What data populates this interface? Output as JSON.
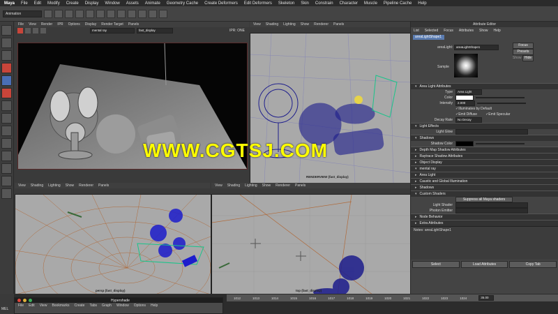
{
  "menubar": {
    "app": "Maya",
    "items": [
      "File",
      "Edit",
      "Modify",
      "Create",
      "Display",
      "Window",
      "Assets",
      "Animate",
      "Geometry Cache",
      "Create Deformers",
      "Edit Deformers",
      "Skeleton",
      "Skin",
      "Constrain",
      "Character",
      "Muscle",
      "Pipeline Cache",
      "Help"
    ]
  },
  "shelf": {
    "mode": "Animation"
  },
  "render_view": {
    "menu": [
      "File",
      "View",
      "Render",
      "IPR",
      "Options",
      "Display",
      "Render Target",
      "Panels"
    ],
    "renderer": "mental ray",
    "camera": "fast_display",
    "ipr_label": "IPR: ONE"
  },
  "viewports": {
    "top_right": {
      "menu": [
        "View",
        "Shading",
        "Lighting",
        "Show",
        "Renderer",
        "Panels"
      ],
      "label": "RENDERVIEW (fast_display)"
    },
    "bottom_left": {
      "menu": [
        "View",
        "Shading",
        "Lighting",
        "Show",
        "Renderer",
        "Panels"
      ],
      "label": "persp (fast_display)"
    },
    "bottom_right": {
      "menu": [
        "View",
        "Shading",
        "Lighting",
        "Show",
        "Renderer",
        "Panels"
      ],
      "label": "top (fast_display)"
    }
  },
  "watermark": "WWW.CGTSJ.COM",
  "attribute_editor": {
    "title": "Attribute Editor",
    "menu": [
      "List",
      "Selected",
      "Focus",
      "Attributes",
      "Show",
      "Help"
    ],
    "tab": "areaLightShape1",
    "node_label": "areaLight:",
    "node_value": "areaLightShape1",
    "focus": "Focus",
    "presets": "Presets",
    "show": "Show",
    "hide": "Hide",
    "sample_label": "Sample",
    "section_area": "Area Light Attributes",
    "type_label": "Type",
    "type_value": "Area Light",
    "color_label": "Color",
    "intensity_label": "Intensity",
    "intensity_value": "2.000",
    "illum_default": "Illuminates by Default",
    "emit_diffuse": "Emit Diffuse",
    "emit_specular": "Emit Specular",
    "decay_label": "Decay Rate",
    "decay_value": "No Decay",
    "light_effects": "Light Effects",
    "light_glow": "Light Glow",
    "shadows": "Shadows",
    "shadow_color": "Shadow Color",
    "depth_map": "Depth Map Shadow Attributes",
    "raytrace": "Raytrace Shadow Attributes",
    "object_display": "Object Display",
    "mental_ray": "mental ray",
    "area_light": "Area Light",
    "caustic": "Caustic and Global Illumination",
    "shadows2": "Shadows",
    "custom_shaders": "Custom Shaders",
    "suppress": "Suppress all Maya shaders",
    "light_shader": "Light Shader",
    "photon_emitter": "Photon Emitter",
    "node_behavior": "Node Behavior",
    "extra_attributes": "Extra Attributes",
    "notes": "Notes: areaLightShape1",
    "select_btn": "Select",
    "load_btn": "Load Attributes",
    "copy_btn": "Copy Tab"
  },
  "hypershade": {
    "title": "Hypershade",
    "menu": [
      "File",
      "Edit",
      "View",
      "Bookmarks",
      "Create",
      "Tabs",
      "Graph",
      "Window",
      "Options",
      "Help"
    ]
  },
  "timeline": {
    "ticks": [
      "1012",
      "1013",
      "1014",
      "1015",
      "1016",
      "1017",
      "1018",
      "1019",
      "1020",
      "1021",
      "1022",
      "1023",
      "1024"
    ],
    "current": "35.00"
  },
  "mel_label": "MEL"
}
